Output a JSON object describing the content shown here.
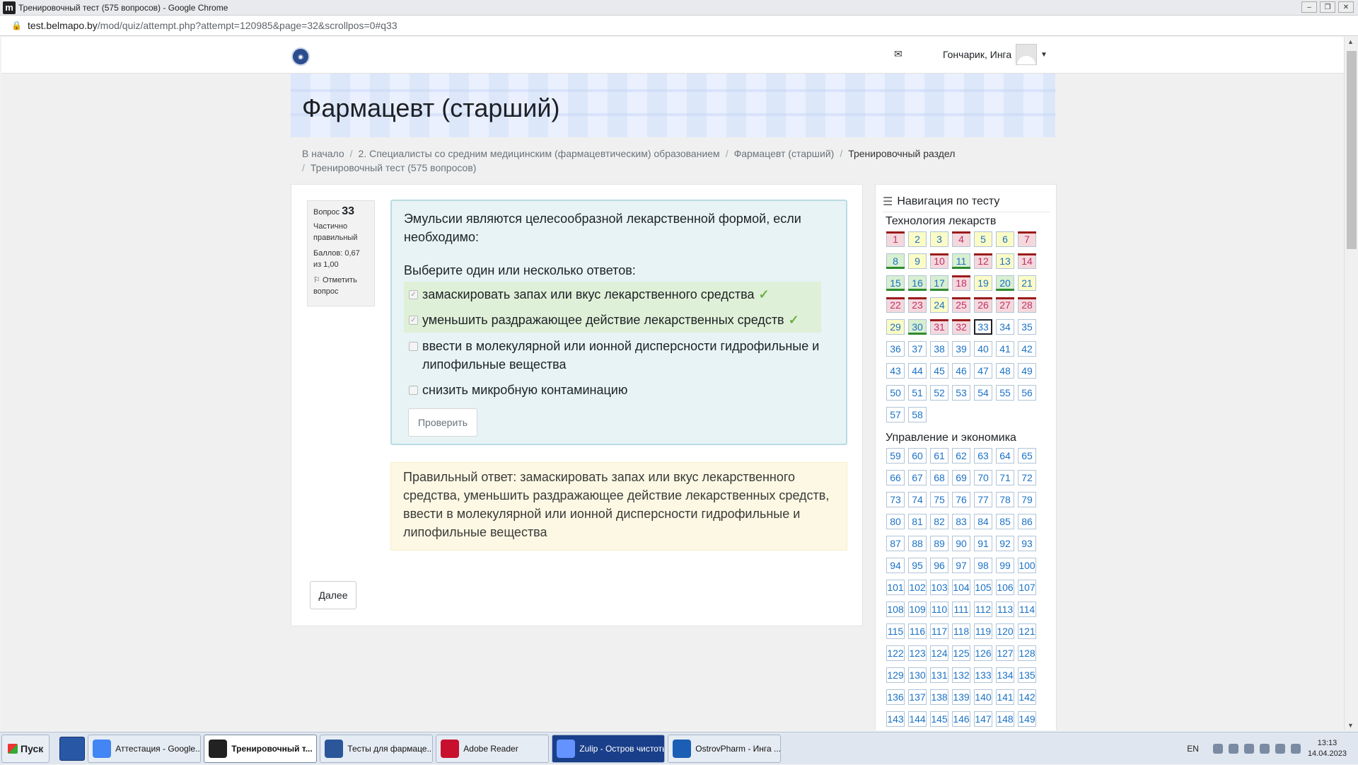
{
  "window": {
    "title": "Тренировочный тест (575 вопросов) - Google Chrome",
    "url_host": "test.belmapo.by",
    "url_path": "/mod/quiz/attempt.php?attempt=120985&page=32&scrollpos=0#q33"
  },
  "navbar": {
    "username": "Гончарик, Инга"
  },
  "header": {
    "course_title": "Фармацевт (старший)"
  },
  "breadcrumb": [
    "В начало",
    "2. Специалисты со средним медицинским (фармацевтическим) образованием",
    "Фармацевт (старший)",
    "Тренировочный раздел",
    "Тренировочный тест (575 вопросов)"
  ],
  "question": {
    "label": "Вопрос",
    "number": "33",
    "state": "Частично правильный",
    "grade": "Баллов: 0,67 из 1,00",
    "flag": "Отметить вопрос",
    "text": "Эмульсии являются целесообразной лекарственной формой, если необходимо:",
    "prompt": "Выберите один или несколько ответов:",
    "answers": [
      {
        "text": "замаскировать запах или вкус лекарственного средства",
        "checked": true,
        "correct": true
      },
      {
        "text": "уменьшить раздражающее действие лекарственных средств",
        "checked": true,
        "correct": true
      },
      {
        "text": "ввести в молекулярной или ионной дисперсности гидрофильные и липофильные вещества",
        "checked": false,
        "correct": false
      },
      {
        "text": "снизить микробную контаминацию",
        "checked": false,
        "correct": false
      }
    ],
    "check_button": "Проверить",
    "right_answer": "Правильный ответ: замаскировать запах или вкус лекарственного средства, уменьшить раздражающее действие лекарственных средств, ввести в молекулярной или ионной дисперсности гидрофильные и липофильные вещества",
    "next_button": "Далее"
  },
  "quiz_nav": {
    "title": "Навигация по тесту",
    "sections": [
      {
        "title": "Технология лекарств",
        "buttons": [
          {
            "n": "1",
            "s": "wrong"
          },
          {
            "n": "2",
            "s": "partial"
          },
          {
            "n": "3",
            "s": "partial"
          },
          {
            "n": "4",
            "s": "wrong"
          },
          {
            "n": "5",
            "s": "partial"
          },
          {
            "n": "6",
            "s": "partial"
          },
          {
            "n": "7",
            "s": "wrong"
          },
          {
            "n": "8",
            "s": "correct"
          },
          {
            "n": "9",
            "s": "partial"
          },
          {
            "n": "10",
            "s": "wrong"
          },
          {
            "n": "11",
            "s": "correct"
          },
          {
            "n": "12",
            "s": "wrong"
          },
          {
            "n": "13",
            "s": "partial"
          },
          {
            "n": "14",
            "s": "wrong"
          },
          {
            "n": "15",
            "s": "correct"
          },
          {
            "n": "16",
            "s": "correct"
          },
          {
            "n": "17",
            "s": "correct"
          },
          {
            "n": "18",
            "s": "wrong"
          },
          {
            "n": "19",
            "s": "partial"
          },
          {
            "n": "20",
            "s": "correct"
          },
          {
            "n": "21",
            "s": "partial"
          },
          {
            "n": "22",
            "s": "wrong"
          },
          {
            "n": "23",
            "s": "wrong"
          },
          {
            "n": "24",
            "s": "partial"
          },
          {
            "n": "25",
            "s": "wrong"
          },
          {
            "n": "26",
            "s": "wrong"
          },
          {
            "n": "27",
            "s": "wrong"
          },
          {
            "n": "28",
            "s": "wrong"
          },
          {
            "n": "29",
            "s": "partial"
          },
          {
            "n": "30",
            "s": "correct"
          },
          {
            "n": "31",
            "s": "wrong"
          },
          {
            "n": "32",
            "s": "wrong"
          },
          {
            "n": "33",
            "s": "current"
          },
          {
            "n": "34",
            "s": ""
          },
          {
            "n": "35",
            "s": ""
          },
          {
            "n": "36",
            "s": ""
          },
          {
            "n": "37",
            "s": ""
          },
          {
            "n": "38",
            "s": ""
          },
          {
            "n": "39",
            "s": ""
          },
          {
            "n": "40",
            "s": ""
          },
          {
            "n": "41",
            "s": ""
          },
          {
            "n": "42",
            "s": ""
          },
          {
            "n": "43",
            "s": ""
          },
          {
            "n": "44",
            "s": ""
          },
          {
            "n": "45",
            "s": ""
          },
          {
            "n": "46",
            "s": ""
          },
          {
            "n": "47",
            "s": ""
          },
          {
            "n": "48",
            "s": ""
          },
          {
            "n": "49",
            "s": ""
          },
          {
            "n": "50",
            "s": ""
          },
          {
            "n": "51",
            "s": ""
          },
          {
            "n": "52",
            "s": ""
          },
          {
            "n": "53",
            "s": ""
          },
          {
            "n": "54",
            "s": ""
          },
          {
            "n": "55",
            "s": ""
          },
          {
            "n": "56",
            "s": ""
          },
          {
            "n": "57",
            "s": ""
          },
          {
            "n": "58",
            "s": ""
          }
        ]
      },
      {
        "title": "Управление и экономика",
        "range": [
          59,
          149
        ]
      }
    ]
  },
  "taskbar": {
    "start": "Пуск",
    "tasks": [
      {
        "label": "Аттестация - Google...",
        "color": "#4285f4",
        "active": false,
        "style": ""
      },
      {
        "label": "Тренировочный т...",
        "color": "#222222",
        "active": true,
        "style": ""
      },
      {
        "label": "Тесты для фармаце...",
        "color": "#2b579a",
        "active": false,
        "style": ""
      },
      {
        "label": "Adobe Reader",
        "color": "#c8102e",
        "active": false,
        "style": ""
      },
      {
        "label": "Zulip - Остров чистоты",
        "color": "#6492fe",
        "active": false,
        "style": "zulip"
      },
      {
        "label": "OstrovPharm - Инга ...",
        "color": "#1a5fb4",
        "active": false,
        "style": ""
      }
    ],
    "lang": "EN",
    "time": "13:13",
    "date": "14.04.2023"
  }
}
